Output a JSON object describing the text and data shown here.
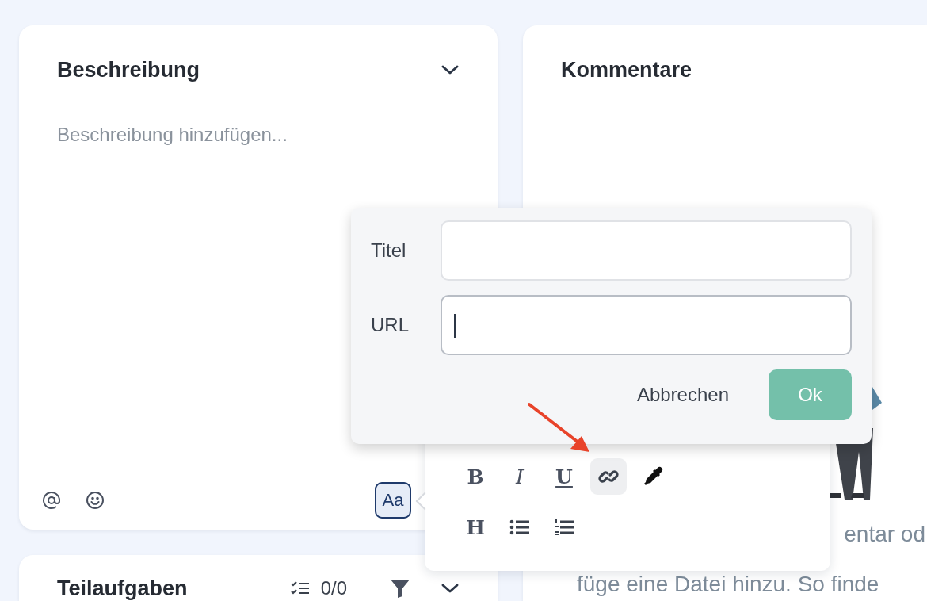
{
  "description": {
    "title": "Beschreibung",
    "placeholder": "Beschreibung hinzufügen...",
    "format_button": {
      "label": "Aa",
      "selected": true
    }
  },
  "comments": {
    "title": "Kommentare",
    "text_lines": [
      "entar od",
      "füge eine Datei hinzu. So finde"
    ]
  },
  "subtasks": {
    "title": "Teilaufgaben",
    "count": "0/0"
  },
  "link_dialog": {
    "fields": [
      {
        "label": "Titel",
        "focused": false
      },
      {
        "label": "URL",
        "focused": true
      }
    ],
    "cancel": "Abbrechen",
    "ok": "Ok"
  },
  "toolbar": {
    "rows": [
      [
        {
          "kind": "bold",
          "glyph": "B",
          "selected": false
        },
        {
          "kind": "italic",
          "glyph": "I",
          "selected": false
        },
        {
          "kind": "underline",
          "glyph": "U",
          "selected": false
        },
        {
          "kind": "link",
          "selected": true
        },
        {
          "kind": "color-picker",
          "selected": false
        }
      ],
      [
        {
          "kind": "heading",
          "glyph": "H",
          "selected": false
        },
        {
          "kind": "bullet-list",
          "selected": false
        },
        {
          "kind": "numbered-list",
          "selected": false
        }
      ]
    ]
  }
}
